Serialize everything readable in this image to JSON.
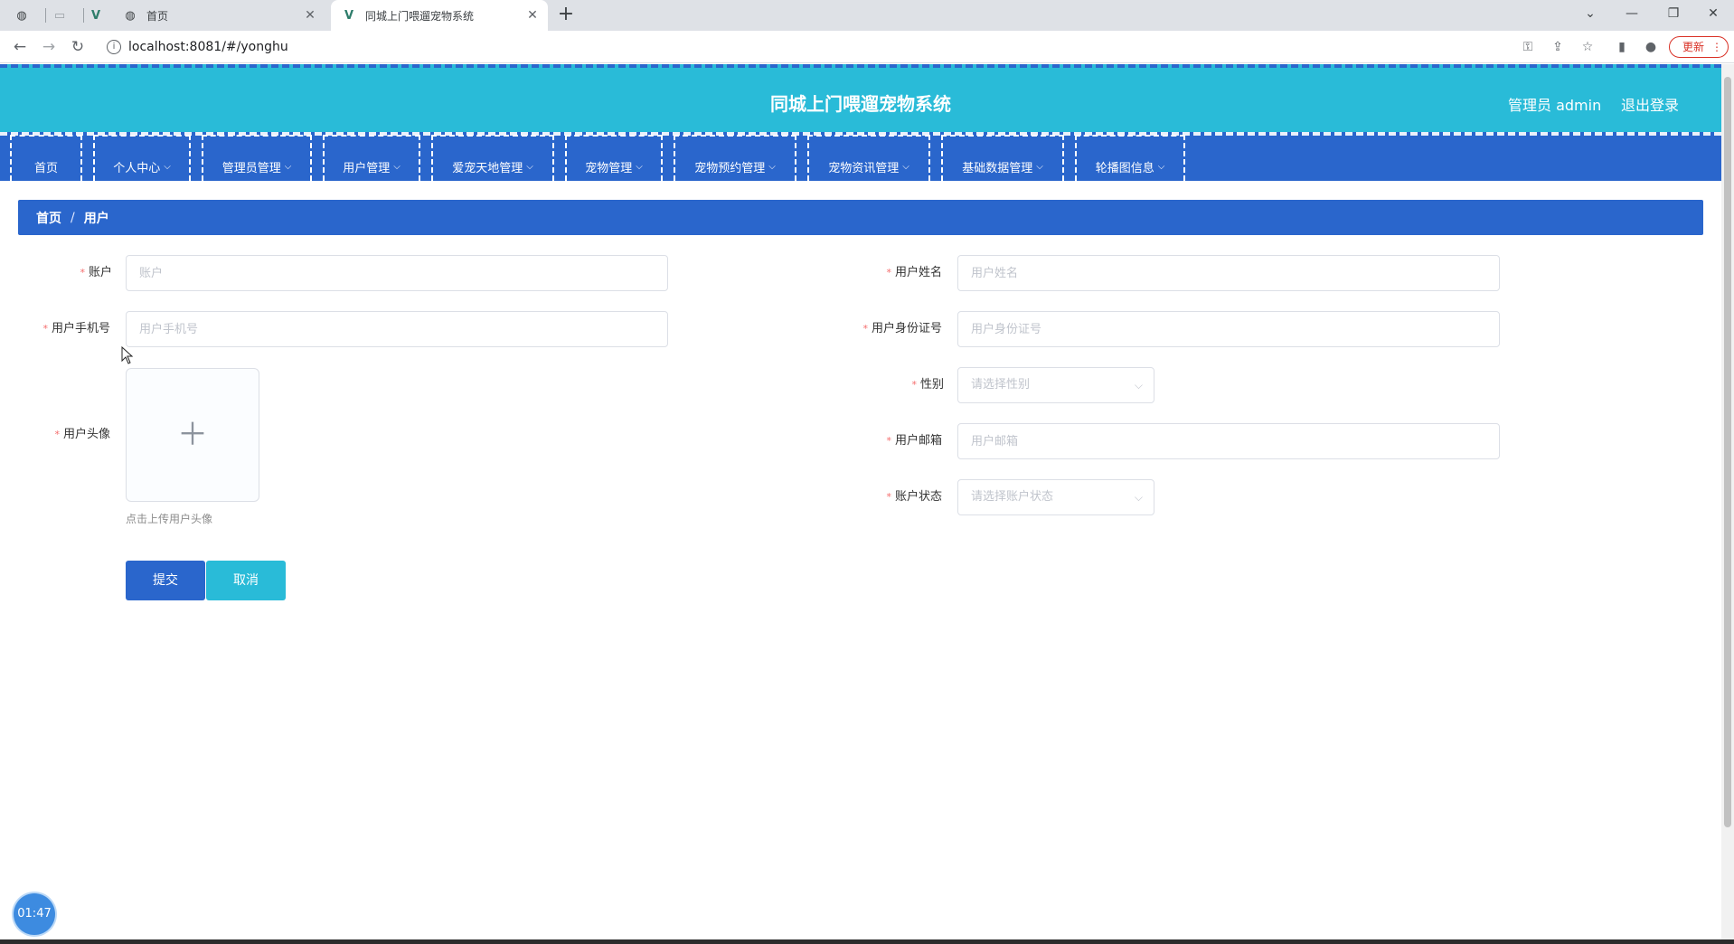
{
  "browser": {
    "tabs": [
      {
        "title": "",
        "icon": "globe-icon",
        "active": false
      },
      {
        "title": "",
        "icon": "blank-page-icon",
        "active": false
      },
      {
        "title": "",
        "icon": "vue-logo-icon",
        "active": false
      },
      {
        "title": "首页",
        "icon": "globe-icon",
        "active": false
      },
      {
        "title": "同城上门喂遛宠物系统",
        "icon": "vue-logo-icon",
        "active": true
      }
    ],
    "url": "localhost:8081/#/yonghu",
    "update_label": "更新"
  },
  "header": {
    "title": "同城上门喂遛宠物系统",
    "user": "管理员 admin",
    "logout": "退出登录"
  },
  "menu": [
    {
      "label": "首页",
      "has_dropdown": false
    },
    {
      "label": "个人中心",
      "has_dropdown": true
    },
    {
      "label": "管理员管理",
      "has_dropdown": true
    },
    {
      "label": "用户管理",
      "has_dropdown": true
    },
    {
      "label": "爱宠天地管理",
      "has_dropdown": true
    },
    {
      "label": "宠物管理",
      "has_dropdown": true
    },
    {
      "label": "宠物预约管理",
      "has_dropdown": true
    },
    {
      "label": "宠物资讯管理",
      "has_dropdown": true
    },
    {
      "label": "基础数据管理",
      "has_dropdown": true
    },
    {
      "label": "轮播图信息",
      "has_dropdown": true
    }
  ],
  "breadcrumb": {
    "home": "首页",
    "separator": "/",
    "current": "用户"
  },
  "form": {
    "account": {
      "label": "账户",
      "placeholder": "账户",
      "value": ""
    },
    "name": {
      "label": "用户姓名",
      "placeholder": "用户姓名",
      "value": ""
    },
    "phone": {
      "label": "用户手机号",
      "placeholder": "用户手机号",
      "value": ""
    },
    "id_number": {
      "label": "用户身份证号",
      "placeholder": "用户身份证号",
      "value": ""
    },
    "avatar": {
      "label": "用户头像",
      "tip": "点击上传用户头像"
    },
    "gender": {
      "label": "性别",
      "placeholder": "请选择性别"
    },
    "email": {
      "label": "用户邮箱",
      "placeholder": "用户邮箱",
      "value": ""
    },
    "status": {
      "label": "账户状态",
      "placeholder": "请选择账户状态"
    },
    "required_mark": "*",
    "submit": "提交",
    "cancel": "取消"
  },
  "timer": "01:47",
  "colors": {
    "header": "#29bbd8",
    "menu": "#2a66cc",
    "required": "#f56c6c"
  }
}
